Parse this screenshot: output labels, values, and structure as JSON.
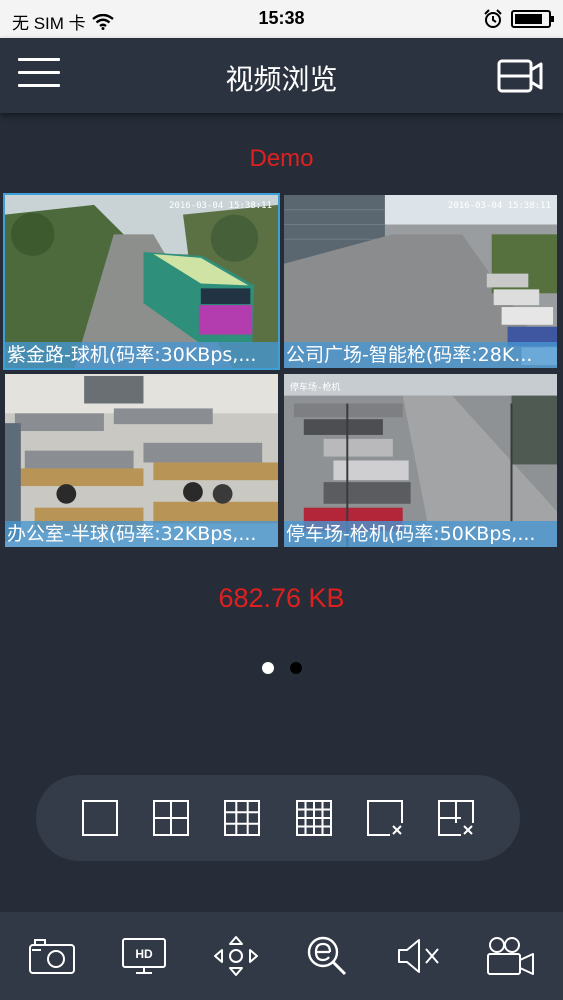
{
  "status_bar": {
    "carrier": "无 SIM 卡",
    "time": "15:38",
    "icons": [
      "wifi-icon",
      "alarm-icon",
      "battery-icon"
    ],
    "battery_level": 0.85
  },
  "header": {
    "title": "视频浏览",
    "left_icon": "menu-icon",
    "right_icon": "camera-list-icon"
  },
  "device_name": "Demo",
  "channels": [
    {
      "label": "紫金路-球机(码率:30KBps,...",
      "timestamp": "2016-03-04 15:38:11",
      "selected": true,
      "scene": "street-with-bus"
    },
    {
      "label": "公司广场-智能枪(码率:28K...",
      "timestamp": "2016-03-04 15:38:11",
      "selected": false,
      "scene": "plaza-parking"
    },
    {
      "label": "办公室-半球(码率:32KBps,...",
      "timestamp": "",
      "selected": false,
      "scene": "office"
    },
    {
      "label": "停车场-枪机(码率:50KBps,...",
      "timestamp": "停车场-枪机",
      "selected": false,
      "scene": "parking-lot"
    }
  ],
  "speed": "682.76 KB",
  "pager": {
    "pages": 2,
    "current": 1
  },
  "layout_options": [
    {
      "name": "layout-1-icon"
    },
    {
      "name": "layout-4-icon"
    },
    {
      "name": "layout-9-icon"
    },
    {
      "name": "layout-16-icon"
    },
    {
      "name": "close-single-icon"
    },
    {
      "name": "close-all-icon"
    }
  ],
  "toolbar": [
    {
      "name": "snapshot-icon"
    },
    {
      "name": "hd-icon",
      "label": "HD"
    },
    {
      "name": "ptz-icon"
    },
    {
      "name": "zoom-icon"
    },
    {
      "name": "mute-icon"
    },
    {
      "name": "record-icon"
    }
  ],
  "colors": {
    "background": "#262d38",
    "accent_red": "#e02020",
    "selection_blue": "#3d9fd6",
    "label_bar": "#4696d2"
  }
}
